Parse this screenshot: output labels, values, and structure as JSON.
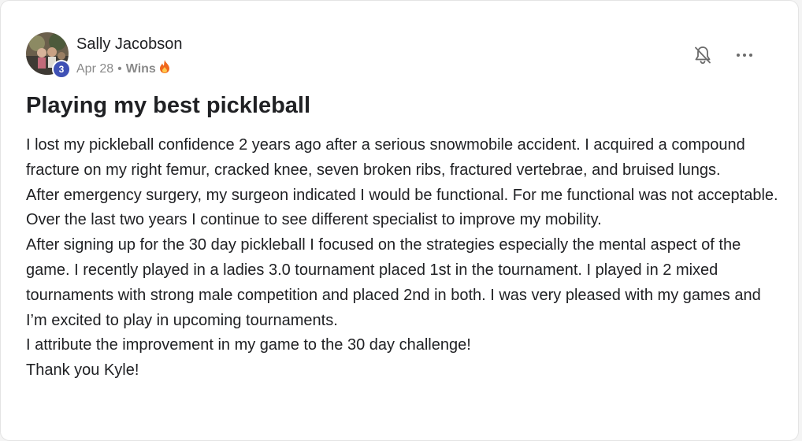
{
  "post": {
    "author": "Sally Jacobson",
    "level": "3",
    "date": "Apr 28",
    "separator": "•",
    "category": "Wins",
    "category_icon": "fire-icon",
    "title": "Playing my best pickleball",
    "body": [
      "I lost my pickleball confidence 2 years ago after a serious snowmobile accident. I acquired a compound fracture on my right femur, cracked knee, seven broken ribs, fractured vertebrae, and bruised lungs.",
      "After emergency surgery, my surgeon indicated I would be functional. For me functional was not acceptable. Over the last two years I continue to see different specialist to improve my mobility.",
      "After signing up for the 30 day pickleball I focused on the strategies especially the mental aspect of the game. I recently played in a ladies 3.0 tournament placed 1st in the tournament. I played in 2 mixed tournaments with strong male competition and placed 2nd in both. I was very pleased with my games and I’m excited to play in upcoming tournaments.",
      "I attribute the improvement in my game to the 30 day challenge!",
      "Thank you Kyle!"
    ]
  },
  "actions": {
    "notify_icon": "bell-off-icon",
    "more_icon": "more-horizontal-icon"
  },
  "colors": {
    "level_badge": "#3f51b5",
    "text": "#202124",
    "muted": "#8a8a8a",
    "fire": "#f0661c"
  }
}
